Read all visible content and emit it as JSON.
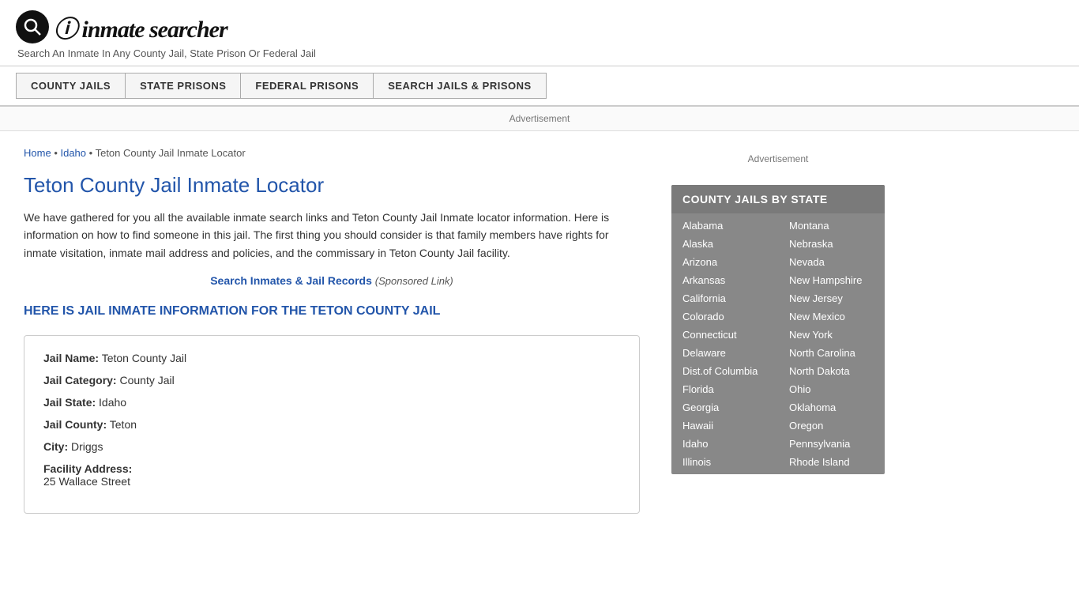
{
  "header": {
    "logo_text": "inmate searcher",
    "tagline": "Search An Inmate In Any County Jail, State Prison Or Federal Jail"
  },
  "nav": {
    "buttons": [
      {
        "id": "county-jails",
        "label": "COUNTY JAILS"
      },
      {
        "id": "state-prisons",
        "label": "STATE PRISONS"
      },
      {
        "id": "federal-prisons",
        "label": "FEDERAL PRISONS"
      },
      {
        "id": "search-jails",
        "label": "SEARCH JAILS & PRISONS"
      }
    ]
  },
  "ad": {
    "top_label": "Advertisement",
    "sidebar_label": "Advertisement"
  },
  "breadcrumb": {
    "home": "Home",
    "state": "Idaho",
    "current": "Teton County Jail Inmate Locator"
  },
  "page": {
    "title": "Teton County Jail Inmate Locator",
    "description": "We have gathered for you all the available inmate search links and Teton County Jail Inmate locator information. Here is information on how to find someone in this jail. The first thing you should consider is that family members have rights for inmate visitation, inmate mail address and policies, and the commissary in Teton County Jail facility.",
    "sponsored_link_text": "Search Inmates & Jail Records",
    "sponsored_suffix": "(Sponsored Link)",
    "section_heading": "HERE IS JAIL INMATE INFORMATION FOR THE TETON COUNTY JAIL"
  },
  "info_box": {
    "fields": [
      {
        "label": "Jail Name:",
        "value": "Teton County Jail"
      },
      {
        "label": "Jail Category:",
        "value": "County Jail"
      },
      {
        "label": "Jail State:",
        "value": "Idaho"
      },
      {
        "label": "Jail County:",
        "value": "Teton"
      },
      {
        "label": "City:",
        "value": "Driggs"
      },
      {
        "label": "Facility Address:",
        "value": "25 Wallace Street"
      }
    ]
  },
  "sidebar": {
    "state_list_title": "COUNTY JAILS BY STATE",
    "states_col1": [
      "Alabama",
      "Alaska",
      "Arizona",
      "Arkansas",
      "California",
      "Colorado",
      "Connecticut",
      "Delaware",
      "Dist.of Columbia",
      "Florida",
      "Georgia",
      "Hawaii",
      "Idaho",
      "Illinois"
    ],
    "states_col2": [
      "Montana",
      "Nebraska",
      "Nevada",
      "New Hampshire",
      "New Jersey",
      "New Mexico",
      "New York",
      "North Carolina",
      "North Dakota",
      "Ohio",
      "Oklahoma",
      "Oregon",
      "Pennsylvania",
      "Rhode Island"
    ]
  }
}
